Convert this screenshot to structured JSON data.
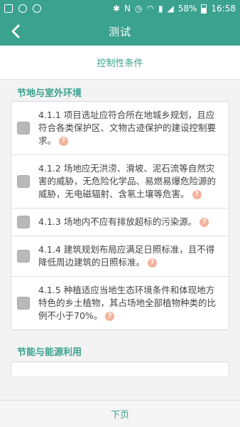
{
  "status_bar": {
    "battery": "58%",
    "time": "16:58"
  },
  "header": {
    "title": "测试"
  },
  "subheader": {
    "label": "控制性条件"
  },
  "sections": [
    {
      "title": "节地与室外环境",
      "items": [
        {
          "text": "4.1.1 项目选址应符合所在地城乡规划，且应符合各类保护区、文物古迹保护的建设控制要求。",
          "checked": false
        },
        {
          "text": "4.1.2 场地应无洪涝、滑坡、泥石流等自然灾害的威胁，无危险化学品、易燃易爆危险源的威胁，无电磁辐射、含氡土壤等危害。",
          "checked": false
        },
        {
          "text": "4.1.3 场地内不应有排放超标的污染源。",
          "checked": false
        },
        {
          "text": "4.1.4 建筑规划布局应满足日照标准，且不得降低周边建筑的日照标准。",
          "checked": false
        },
        {
          "text": "4.1.5 种植适应当地生态环境条件和体现地方特色的乡土植物，其占场地全部植物种类的比例不小于70%。",
          "checked": false
        }
      ]
    },
    {
      "title": "节能与能源利用",
      "items": []
    }
  ],
  "footer": {
    "next_label": "下页"
  },
  "colors": {
    "accent": "#3aa28f",
    "help_icon": "#f3b39d",
    "checkbox": "#b9b9b9"
  }
}
